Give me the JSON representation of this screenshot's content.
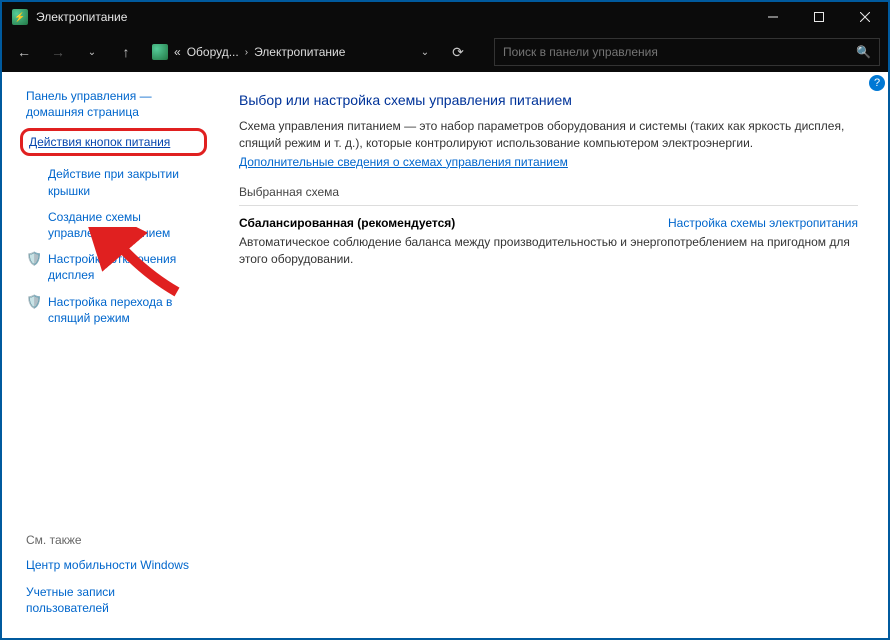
{
  "window": {
    "title": "Электропитание"
  },
  "address": {
    "crumb1": "Оборуд...",
    "crumb2": "Электропитание"
  },
  "search": {
    "placeholder": "Поиск в панели управления"
  },
  "sidebar": {
    "home": "Панель управления — домашняя страница",
    "item_highlight": "Действия кнопок питания",
    "item_lid": "Действие при закрытии крышки",
    "item_create": "Создание схемы управления питанием",
    "item_display": "Настройка отключения дисплея",
    "item_sleep": "Настройка перехода в спящий режим",
    "see_also": "См. также",
    "mob_center": "Центр мобильности Windows",
    "user_acc": "Учетные записи пользователей"
  },
  "main": {
    "heading": "Выбор или настройка схемы управления питанием",
    "description": "Схема управления питанием — это набор параметров оборудования и системы (таких как яркость дисплея, спящий режим и т. д.), которые контролируют использование компьютером электроэнергии.",
    "more_link": "Дополнительные сведения о схемах управления питанием",
    "section": "Выбранная схема",
    "plan_name": "Сбалансированная (рекомендуется)",
    "plan_link": "Настройка схемы электропитания",
    "plan_desc": "Автоматическое соблюдение баланса между производительностью и энергопотреблением на пригодном для этого оборудовании."
  }
}
